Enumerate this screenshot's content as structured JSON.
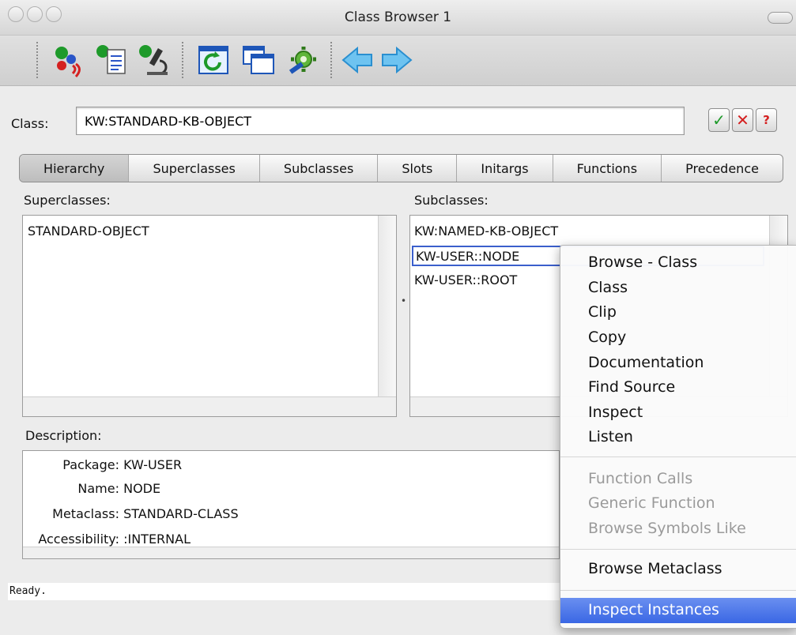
{
  "window": {
    "title": "Class Browser 1"
  },
  "toolbar": {
    "icons": [
      "apps-icon",
      "inspect-document-icon",
      "microscope-icon",
      "refresh-icon",
      "windows-icon",
      "gear-icon",
      "back-arrow-icon",
      "forward-arrow-icon"
    ]
  },
  "class_row": {
    "label": "Class:",
    "value": "KW:STANDARD-KB-OBJECT",
    "buttons": [
      "check-icon",
      "cancel-icon",
      "help-icon"
    ]
  },
  "tabs": [
    "Hierarchy",
    "Superclasses",
    "Subclasses",
    "Slots",
    "Initargs",
    "Functions",
    "Precedence"
  ],
  "superclasses": {
    "label": "Superclasses:",
    "items": [
      "STANDARD-OBJECT"
    ]
  },
  "subclasses": {
    "label": "Subclasses:",
    "items": [
      "KW:NAMED-KB-OBJECT",
      "KW-USER::NODE",
      "KW-USER::ROOT"
    ]
  },
  "description": {
    "label": "Description:",
    "rows": [
      {
        "key": "Package:",
        "value": "KW-USER"
      },
      {
        "key": "Name:",
        "value": "NODE"
      },
      {
        "key": "Metaclass:",
        "value": "STANDARD-CLASS"
      },
      {
        "key": "Accessibility:",
        "value": ":INTERNAL"
      }
    ]
  },
  "status": "Ready.",
  "context_menu": {
    "group1": [
      "Browse - Class",
      "Class",
      "Clip",
      "Copy",
      "Documentation",
      "Find Source",
      "Inspect",
      "Listen"
    ],
    "group2_disabled": [
      "Function Calls",
      "Generic Function",
      "Browse Symbols Like"
    ],
    "group3": [
      "Browse Metaclass"
    ],
    "group4": [
      "Inspect Instances"
    ]
  },
  "colors": {
    "highlight": "#3a67e4",
    "selection_border": "#3b5fcc"
  }
}
